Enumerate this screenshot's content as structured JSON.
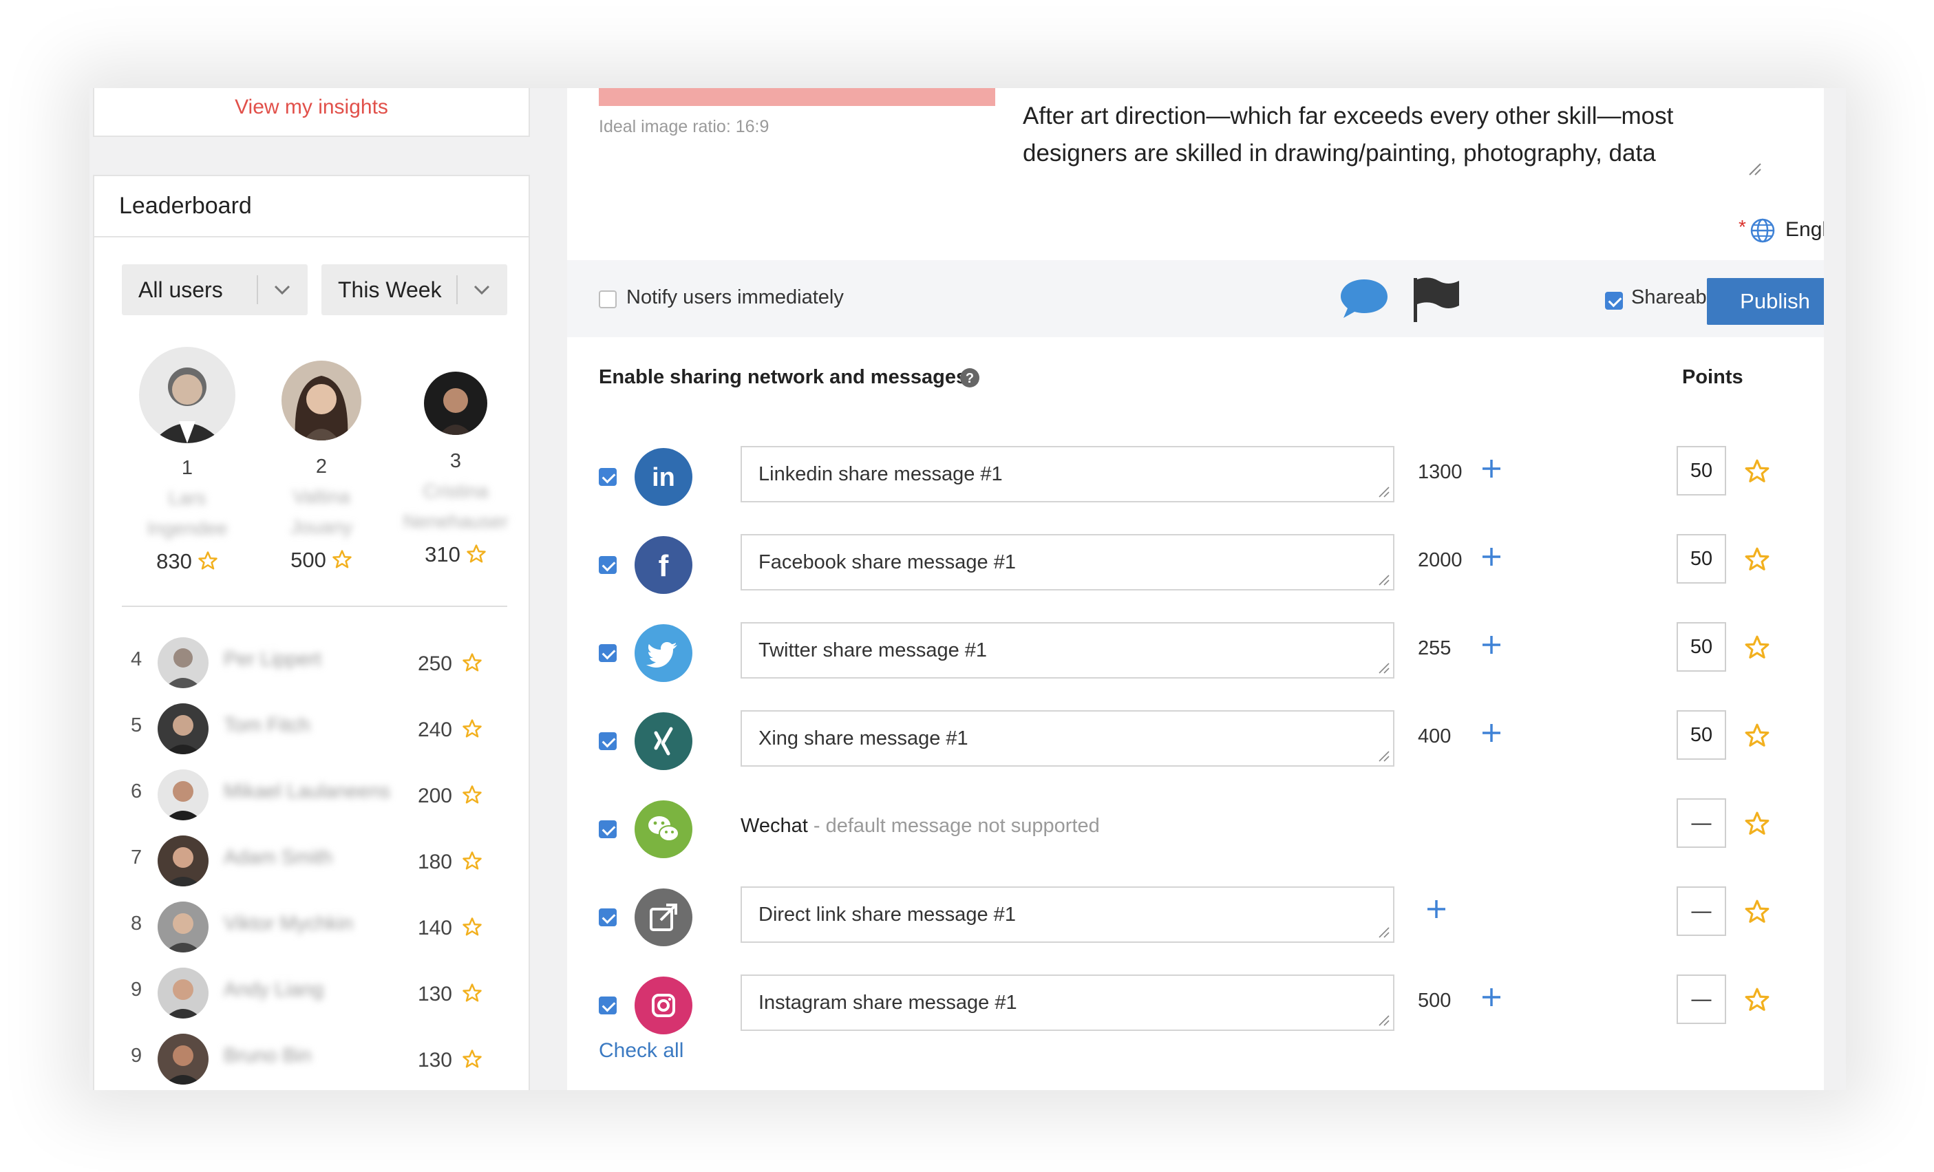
{
  "sidebar": {
    "insights_link": "View my insights",
    "leaderboard_title": "Leaderboard",
    "filter_users": "All users",
    "filter_period": "This Week",
    "podium": [
      {
        "rank": "1",
        "name": "Lars\nIngendee",
        "score": "830"
      },
      {
        "rank": "2",
        "name": "Valtina\nJouany",
        "score": "500"
      },
      {
        "rank": "3",
        "name": "Cristina\nNenehauser",
        "score": "310"
      }
    ],
    "rows": [
      {
        "rank": "4",
        "name": "Per Lippert",
        "score": "250"
      },
      {
        "rank": "5",
        "name": "Tom Fitch",
        "score": "240"
      },
      {
        "rank": "6",
        "name": "Mikael Laulaneens",
        "score": "200"
      },
      {
        "rank": "7",
        "name": "Adam Smith",
        "score": "180"
      },
      {
        "rank": "8",
        "name": "Viktor Mychkin",
        "score": "140"
      },
      {
        "rank": "9",
        "name": "Andy Liang",
        "score": "130"
      },
      {
        "rank": "9",
        "name": "Bruno Bin",
        "score": "130"
      }
    ]
  },
  "editor": {
    "image_ratio_note": "Ideal image ratio: 16:9",
    "description": "After art direction—which far exceeds every other skill—most designers are skilled in drawing/painting, photography, data",
    "language_required_mark": "*",
    "language": "English"
  },
  "actions": {
    "notify_label": "Notify users immediately",
    "notify_checked": false,
    "shareable_label": "Shareable",
    "shareable_checked": true,
    "publish_label": "Publish"
  },
  "sharing": {
    "title": "Enable sharing network and messages",
    "points_header": "Points",
    "check_all": "Check all",
    "networks": [
      {
        "name": "linkedin",
        "icon": "linkedin-icon",
        "color": "#2f6cb0",
        "message": "Linkedin share message #1",
        "count": "1300",
        "points": "50"
      },
      {
        "name": "facebook",
        "icon": "facebook-icon",
        "color": "#3b5a9a",
        "message": "Facebook share message #1",
        "count": "2000",
        "points": "50"
      },
      {
        "name": "twitter",
        "icon": "twitter-icon",
        "color": "#4aa3e0",
        "message": "Twitter share message #1",
        "count": "255",
        "points": "50"
      },
      {
        "name": "xing",
        "icon": "xing-icon",
        "color": "#2a6b68",
        "message": "Xing share message #1",
        "count": "400",
        "points": "50"
      },
      {
        "name": "wechat",
        "icon": "wechat-icon",
        "color": "#7bb440",
        "label": "Wechat",
        "note": " - default message not supported",
        "points": "—"
      },
      {
        "name": "direct-link",
        "icon": "external-link-icon",
        "color": "#6d6d6d",
        "message": "Direct link share message #1",
        "count": "",
        "points": "—"
      },
      {
        "name": "instagram",
        "icon": "instagram-icon",
        "color": "#d6336f",
        "message": "Instagram share message #1",
        "count": "500",
        "points": "—"
      }
    ]
  },
  "colors": {
    "accent": "#3b7ac2",
    "link_red": "#e1504a",
    "star": "#f2b01e"
  }
}
